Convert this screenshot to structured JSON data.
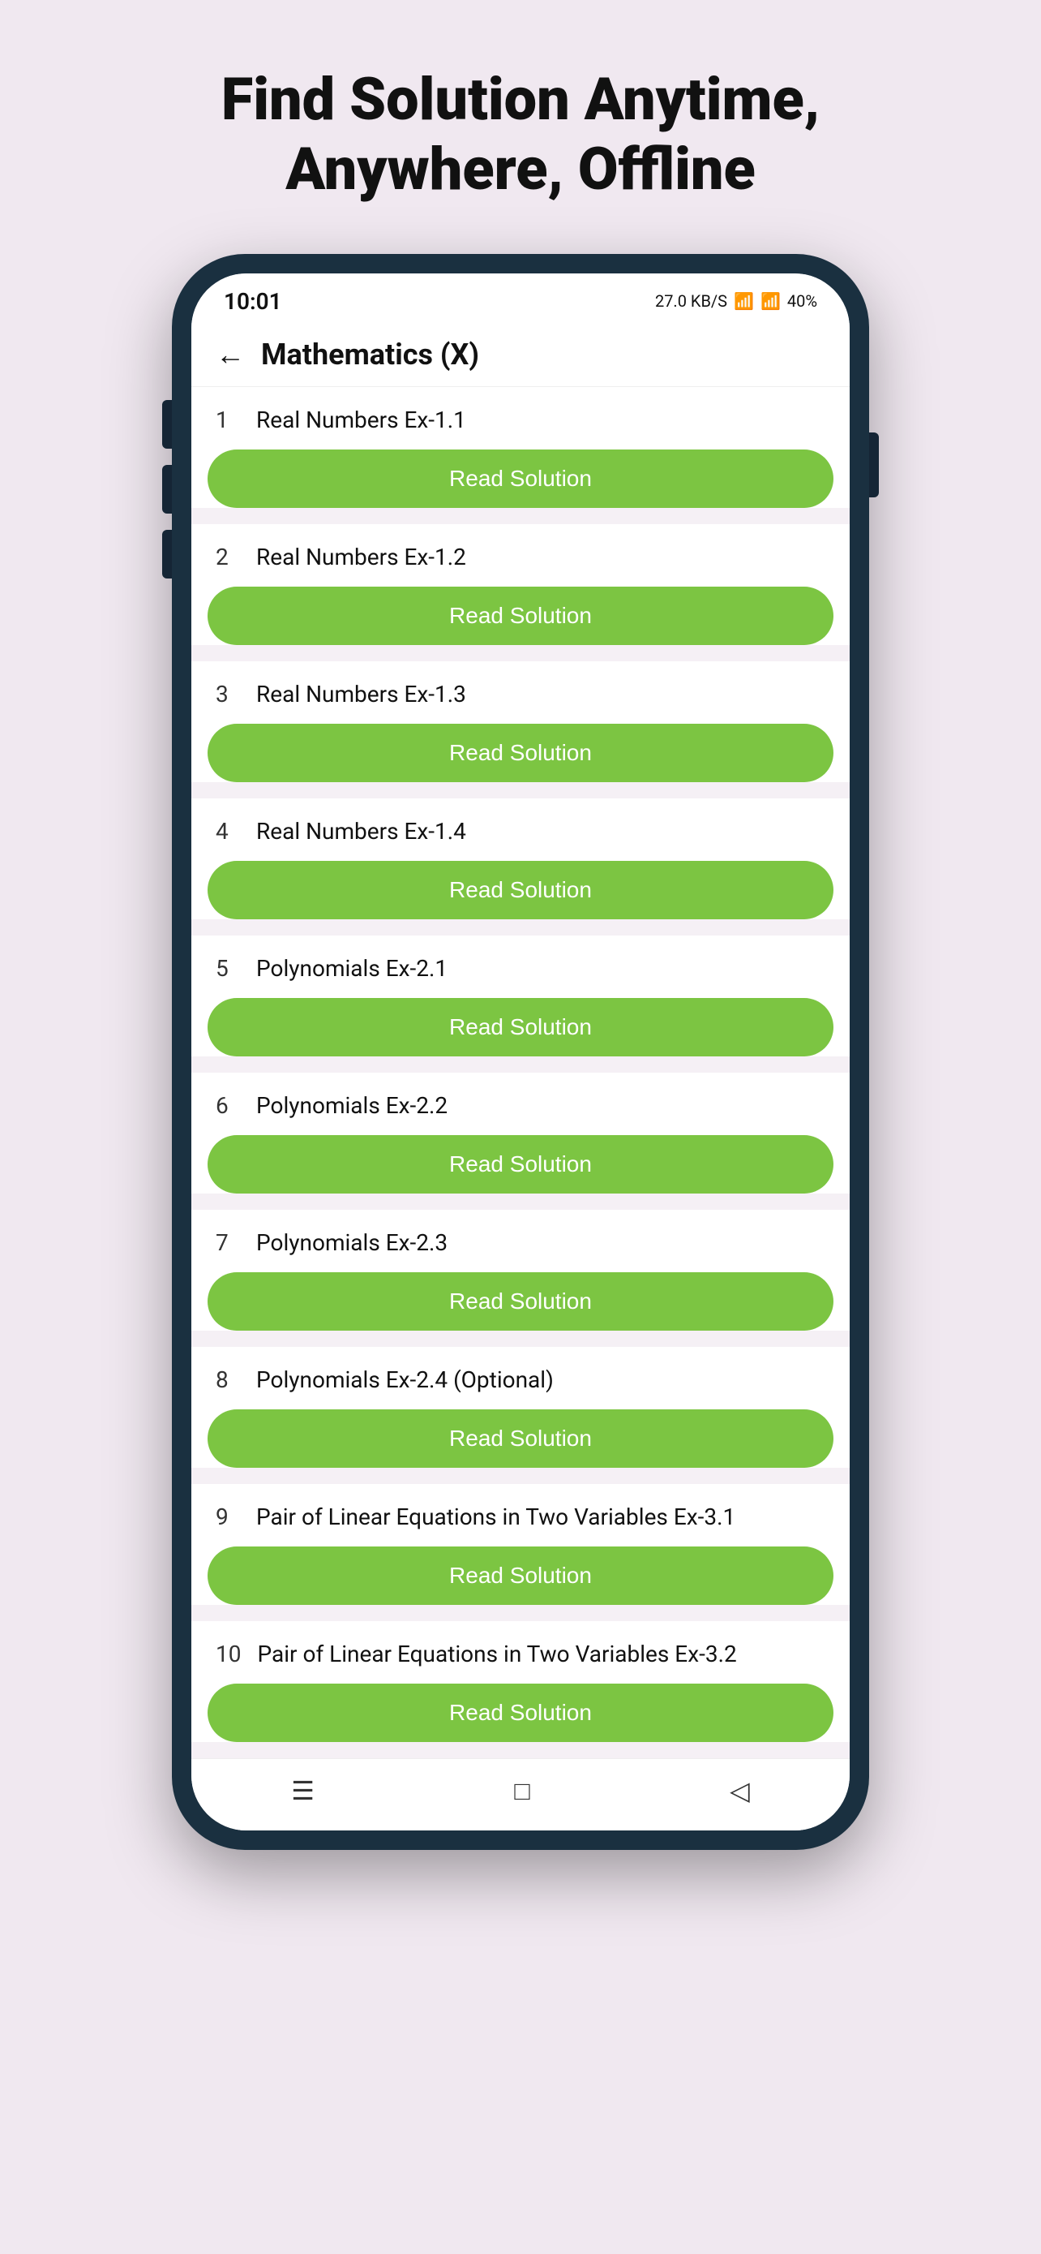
{
  "page": {
    "title_line1": "Find Solution Anytime,",
    "title_line2": "Anywhere, Offline"
  },
  "status_bar": {
    "time": "10:01",
    "battery": "40%",
    "network": "27.0 KB/S"
  },
  "top_bar": {
    "title": "Mathematics (X)",
    "back_label": "←"
  },
  "read_button_label": "Read Solution",
  "nav": {
    "menu_icon": "☰",
    "home_icon": "□",
    "back_icon": "◁"
  },
  "items": [
    {
      "number": "1",
      "label": "Real Numbers Ex-1.1"
    },
    {
      "number": "2",
      "label": "Real Numbers Ex-1.2"
    },
    {
      "number": "3",
      "label": "Real Numbers Ex-1.3"
    },
    {
      "number": "4",
      "label": "Real Numbers Ex-1.4"
    },
    {
      "number": "5",
      "label": "Polynomials Ex-2.1"
    },
    {
      "number": "6",
      "label": "Polynomials Ex-2.2"
    },
    {
      "number": "7",
      "label": "Polynomials Ex-2.3"
    },
    {
      "number": "8",
      "label": "Polynomials Ex-2.4 (Optional)"
    },
    {
      "number": "9",
      "label": "Pair of Linear Equations in Two Variables Ex-3.1"
    },
    {
      "number": "10",
      "label": "Pair of Linear Equations in Two Variables Ex-3.2"
    }
  ]
}
